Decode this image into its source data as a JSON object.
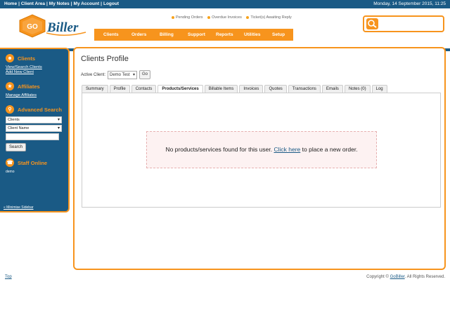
{
  "topbar": {
    "links": [
      "Home",
      "Client Area",
      "My Notes",
      "My Account",
      "Logout"
    ],
    "date": "Monday, 14 September 2015, 11:25"
  },
  "brand": {
    "logo_text_go": "GO",
    "logo_text_biller": "Biller",
    "colors": {
      "navy": "#1a5a85",
      "orange": "#f7941d"
    }
  },
  "notices": {
    "pending": "Pending Orders",
    "overdue": "Overdue Invoices",
    "tickets": "Ticket(s) Awaiting Reply"
  },
  "mainnav": [
    "Clients",
    "Orders",
    "Billing",
    "Support",
    "Reports",
    "Utilities",
    "Setup"
  ],
  "sidebar": {
    "clients_title": "Clients",
    "view_search": "View/Search Clients",
    "add_new": "Add New Client",
    "affiliates_title": "Affiliates",
    "manage_affiliates": "Manage Affiliates",
    "advanced_search_title": "Advanced Search",
    "search_type": "Clients",
    "search_field": "Client Name",
    "search_button": "Search",
    "staff_title": "Staff Online",
    "staff_member": "demo",
    "minimise": "« Minimise Sidebar",
    "icons": [
      "users-icon",
      "affiliates-icon",
      "search-icon",
      "staff-icon"
    ]
  },
  "content": {
    "title": "Clients Profile",
    "active_client_label": "Active Client:",
    "active_client_value": "Demo Test",
    "go_button": "Go",
    "tabs": [
      "Summary",
      "Profile",
      "Contacts",
      "Products/Services",
      "Billable Items",
      "Invoices",
      "Quotes",
      "Transactions",
      "Emails",
      "Notes (0)",
      "Log"
    ],
    "active_tab": "Products/Services",
    "notice_before": "No products/services found for this user.",
    "notice_link": "Click here",
    "notice_after": "to place a new order."
  },
  "footer": {
    "top_link": "Top",
    "copyright_before": "Copyright ©",
    "copyright_link": "GoBiller",
    "copyright_after": ". All Rights Reserved."
  }
}
